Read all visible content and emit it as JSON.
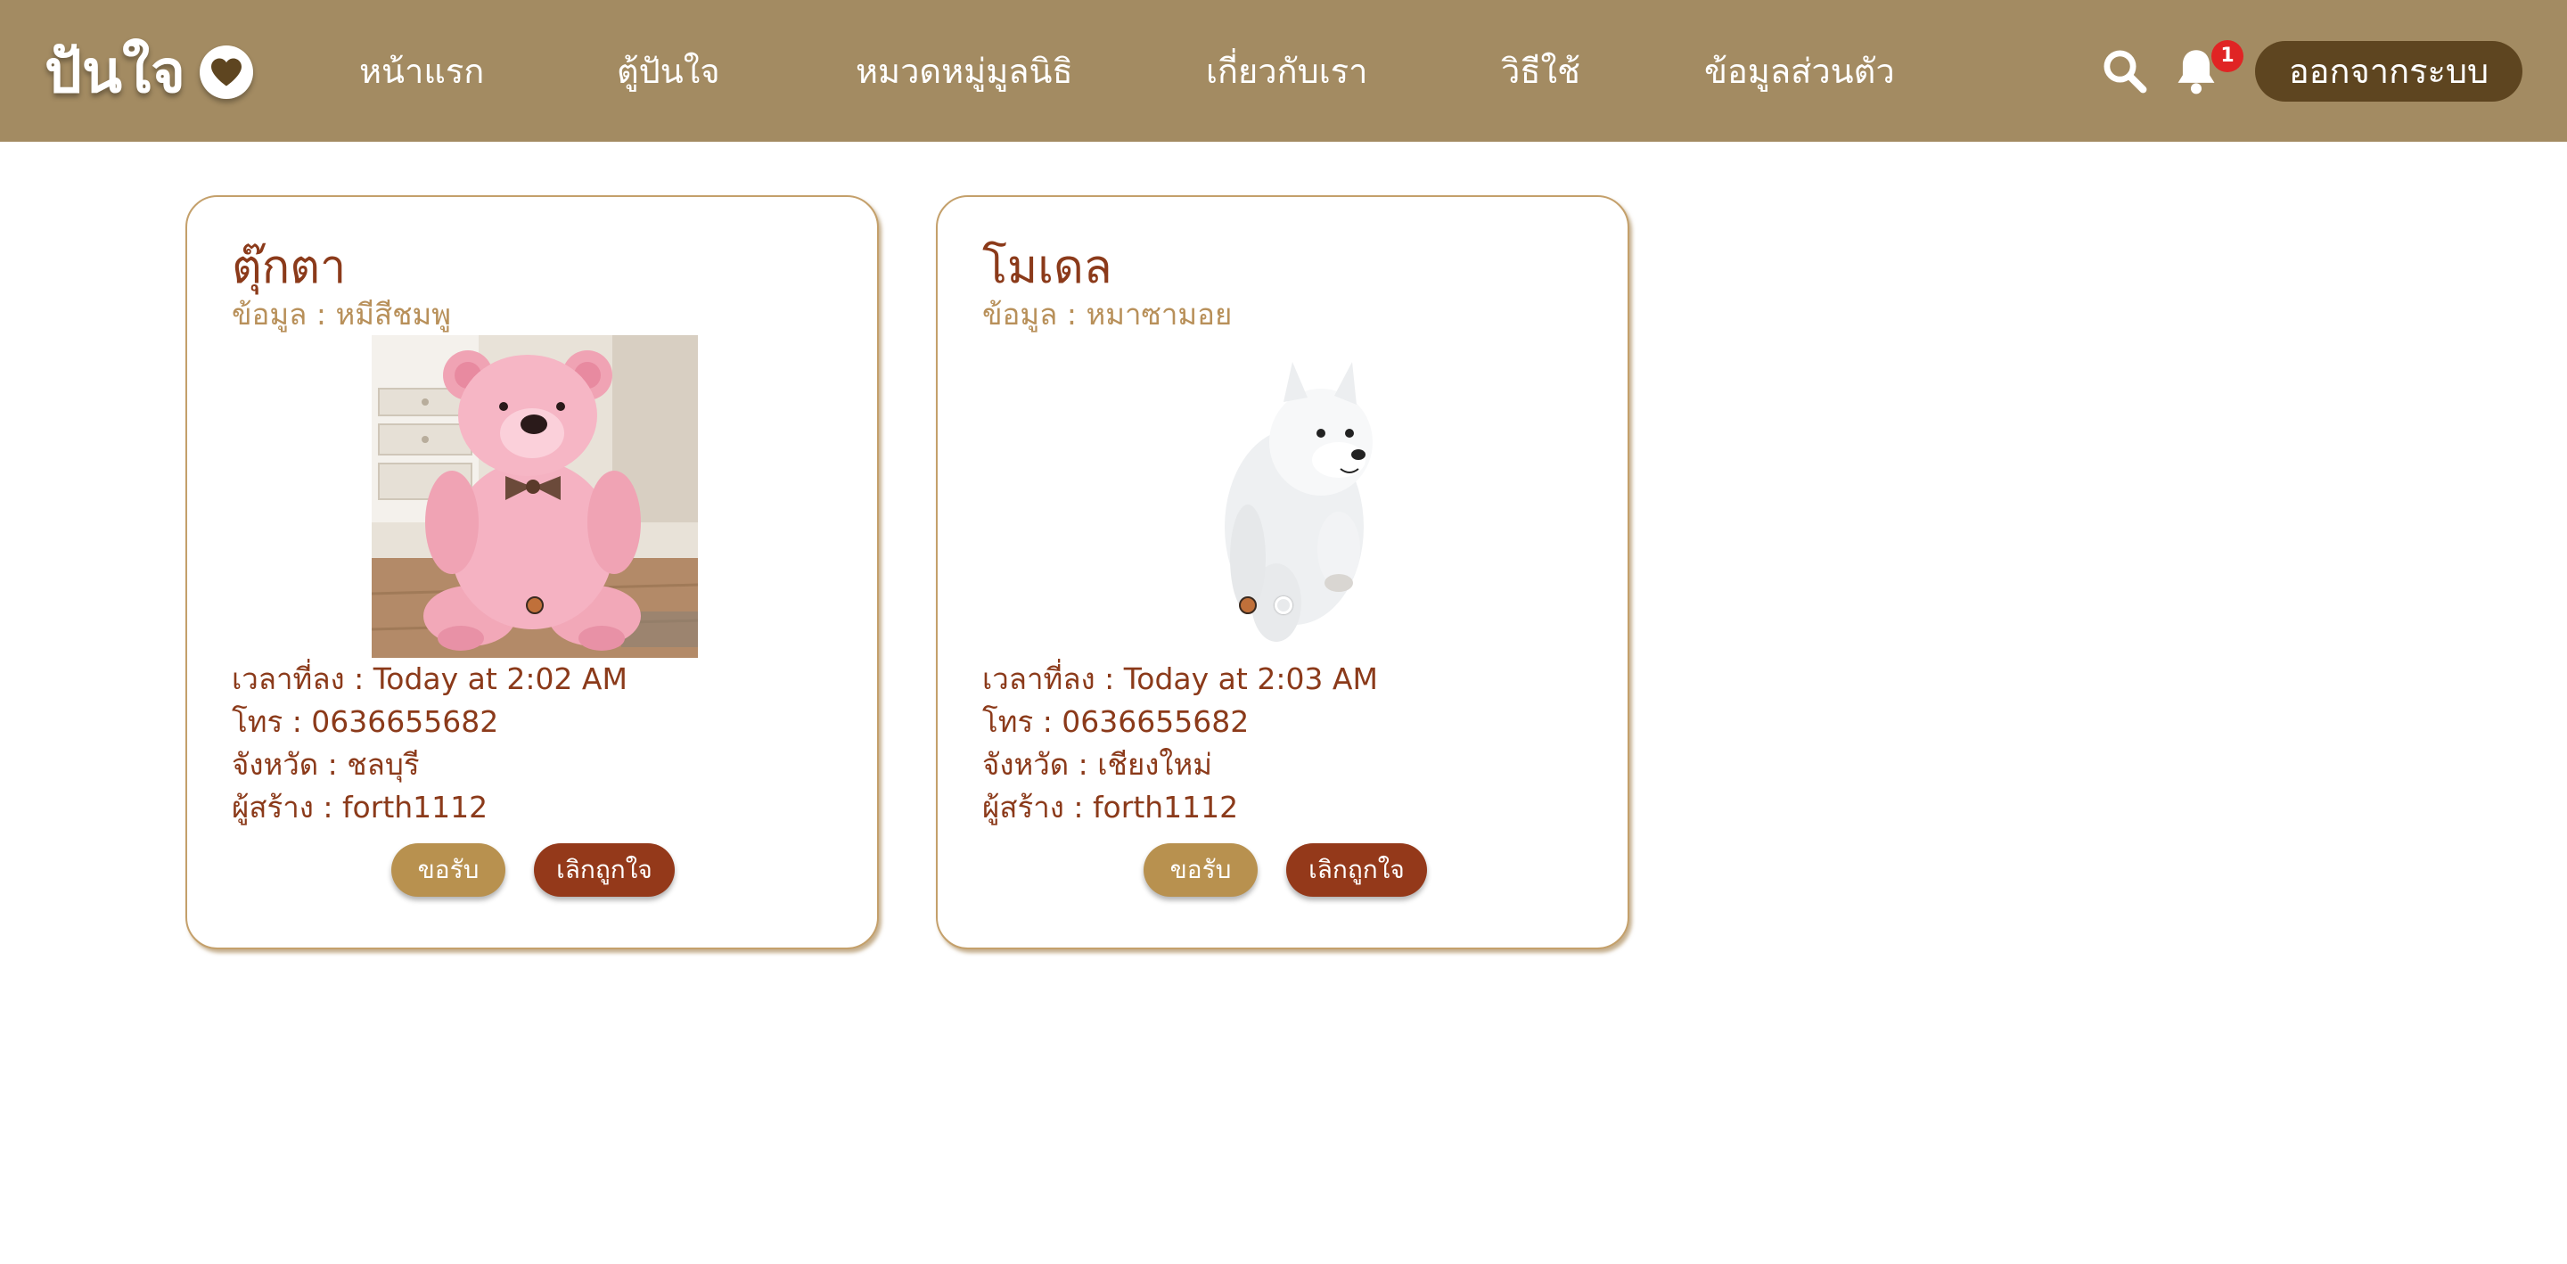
{
  "brand": {
    "name": "ปันใจ",
    "heart_icon": "heart-icon"
  },
  "nav": {
    "items": [
      {
        "label": "หน้าแรก"
      },
      {
        "label": "ตู้ปันใจ"
      },
      {
        "label": "หมวดหมู่มูลนิธิ"
      },
      {
        "label": "เกี่ยวกับเรา"
      },
      {
        "label": "วิธีใช้"
      },
      {
        "label": "ข้อมูลส่วนตัว"
      }
    ],
    "search_icon": "search-icon",
    "bell_icon": "bell-icon",
    "notification_count": "1",
    "logout_label": "ออกจากระบบ"
  },
  "cards": [
    {
      "title": "ตุ๊กตา",
      "info": "ข้อมูล : หมีสีชมพู",
      "image": "pink teddy bear",
      "slides": 1,
      "active_slide": 1,
      "posted": "เวลาที่ลง : Today at 2:02 AM",
      "phone": "โทร : 0636655682",
      "province": "จังหวัด : ชลบุรี",
      "creator": "ผู้สร้าง : forth1112",
      "accept_label": "ขอรับ",
      "cancel_label": "เลิกถูกใจ"
    },
    {
      "title": "โมเดล",
      "info": "ข้อมูล : หมาซามอย",
      "image": "white samoyed dog",
      "slides": 2,
      "active_slide": 1,
      "posted": "เวลาที่ลง : Today at 2:03 AM",
      "phone": "โทร : 0636655682",
      "province": "จังหวัด : เชียงใหม่",
      "creator": "ผู้สร้าง : forth1112",
      "accept_label": "ขอรับ",
      "cancel_label": "เลิกถูกใจ"
    }
  ],
  "colors": {
    "navbar": "#a38b62",
    "logout": "#5e4520",
    "title": "#8b3a1a",
    "info": "#b8905a",
    "accept": "#b8914f",
    "cancel": "#94391a",
    "badge": "#e02424"
  }
}
